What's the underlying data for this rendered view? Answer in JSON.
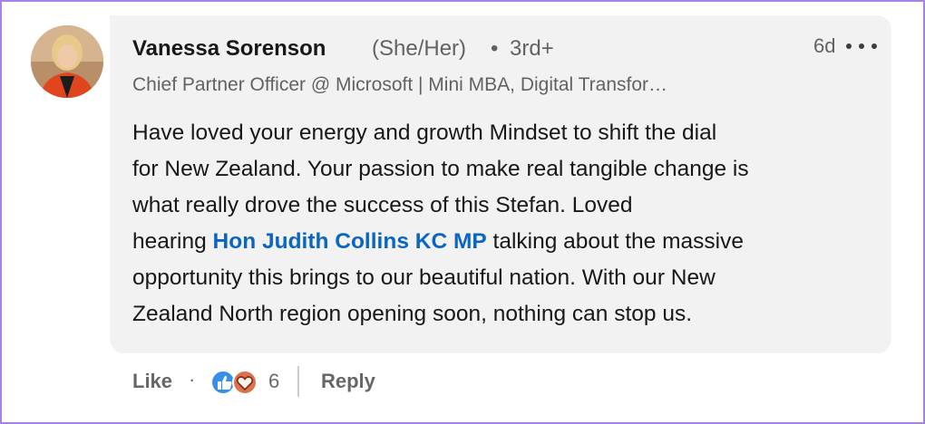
{
  "comment": {
    "author_name": "Vanessa Sorenson",
    "pronouns": "(She/Her)",
    "separator": "•",
    "degree": "3rd+",
    "headline": "Chief Partner Officer @ Microsoft | Mini MBA, Digital Transfor…",
    "timestamp": "6d",
    "body": {
      "line1": "Have loved your energy and growth Mindset to shift the dial",
      "line2": "for New Zealand. Your passion to make real tangible change is",
      "line3": "what really drove the success of this Stefan. Loved",
      "line4_pre": "hearing ",
      "mention": "Hon Judith Collins KC MP",
      "line4_post": " talking about the massive",
      "line5": "opportunity this brings to our beautiful nation. With our New",
      "line6": "Zealand North region opening soon, nothing can stop us."
    }
  },
  "actions": {
    "like_label": "Like",
    "dot": "·",
    "reaction_count": "6",
    "reply_label": "Reply",
    "reaction_icons": [
      "like-reaction-icon",
      "love-reaction-icon"
    ]
  },
  "colors": {
    "bubble_bg": "#f2f2f2",
    "mention": "#0a66c2",
    "like_reaction": "#378fe9",
    "love_reaction": "#df704d",
    "frame": "#a982e8"
  }
}
